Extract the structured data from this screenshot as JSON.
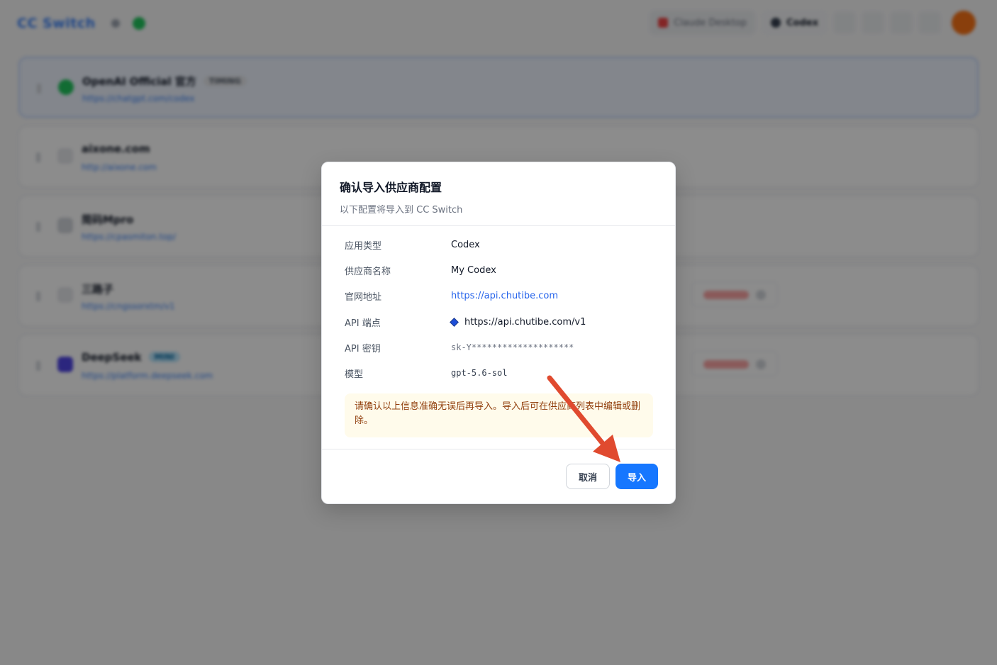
{
  "app": {
    "brand": "CC Switch",
    "header": {
      "apps": [
        {
          "label": "Claude Desktop",
          "color": "#ef4444"
        },
        {
          "label": "Codex",
          "color": "#374151"
        }
      ]
    },
    "providers": [
      {
        "name": "OpenAI Official 官方",
        "badge": "TIMING",
        "url": "https://chatgpt.com/codex",
        "icon_color": "#22c55e",
        "active": true
      },
      {
        "name": "aixone.com",
        "badge": "",
        "url": "http://aixone.com",
        "icon_color": "#e5e7eb",
        "active": false
      },
      {
        "name": "简码Mpro",
        "badge": "",
        "url": "https://cpasmiton.top/",
        "icon_color": "#d1d5db",
        "active": false
      },
      {
        "name": "三路子",
        "badge": "",
        "url": "https://cngssorxtm/v1",
        "icon_color": "#e5e7eb",
        "active": false
      },
      {
        "name": "DeepSeek",
        "badge": "MINI",
        "url": "https://platform.deepseek.com",
        "icon_color": "#4f46e5",
        "active": false
      }
    ]
  },
  "dialog": {
    "title": "确认导入供应商配置",
    "subtitle": "以下配置将导入到 CC Switch",
    "fields": [
      {
        "label": "应用类型",
        "value": "Codex"
      },
      {
        "label": "供应商名称",
        "value": "My Codex"
      },
      {
        "label": "官网地址",
        "value": "https://api.chutibe.com"
      },
      {
        "label": "API 端点",
        "value": "https://api.chutibe.com/v1"
      },
      {
        "label": "API 密钥",
        "value": "sk-Y********************"
      },
      {
        "label": "模型",
        "value": "gpt-5.6-sol"
      }
    ],
    "notice": "请确认以上信息准确无误后再导入。导入后可在供应商列表中编辑或删除。",
    "cancel_label": "取消",
    "import_label": "导入",
    "colors": {
      "primary": "#1677ff",
      "link": "#2563eb",
      "notice_bg": "#fffbeb",
      "notice_text": "#92400e",
      "arrow": "#e04a2f"
    }
  }
}
